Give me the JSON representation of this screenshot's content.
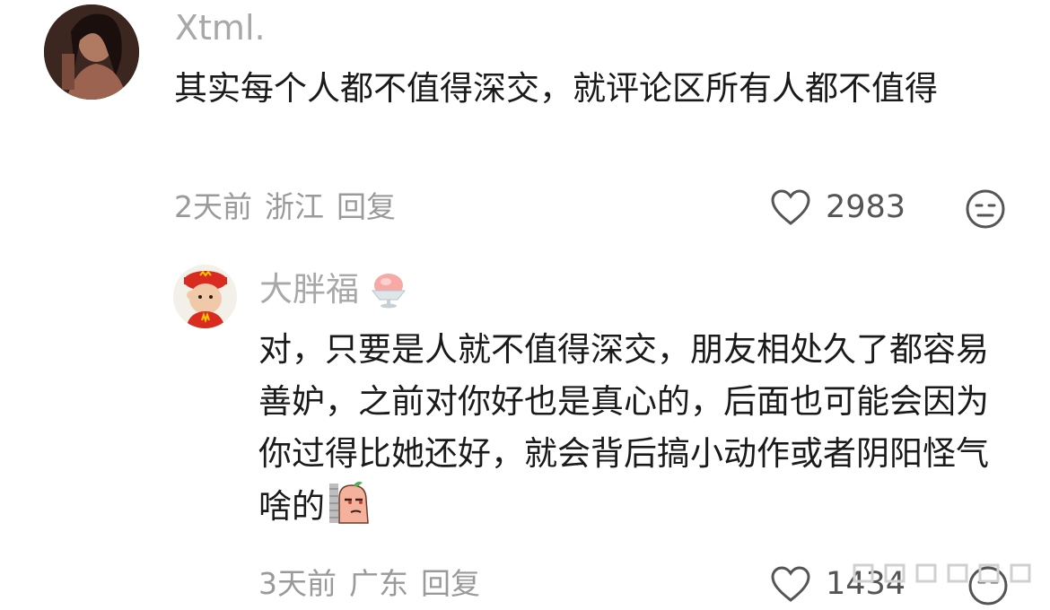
{
  "comments": [
    {
      "username": "Xtml.",
      "avatar_icon": "woman-portrait-avatar",
      "text": "其实每个人都不值得深交，就评论区所有人都不值得",
      "meta": {
        "time": "2天前",
        "location": "浙江",
        "reply": "回复"
      },
      "likes": "2983",
      "reaction_icon": "neutral-face-icon"
    },
    {
      "username": "大胖福",
      "badge_icon": "shaved-ice-icon",
      "avatar_icon": "mcdonalds-baby-avatar",
      "text": "对，只要是人就不值得深交，朋友相处久了都容易善妒，之前对你好也是真心的，后面也可能会因为你过得比她还好，就会背后搞小动作或者阴阳怪气啥的",
      "inline_emoji": "peeking-sly-emoji",
      "meta": {
        "time": "3天前",
        "location": "广东",
        "reply": "回复"
      },
      "likes": "1434",
      "reaction_icon": "neutral-face-icon"
    }
  ],
  "colors": {
    "username": "#a8a8a8",
    "text": "#1a1a1a",
    "meta": "#9a9a9a",
    "icon": "#555555"
  }
}
